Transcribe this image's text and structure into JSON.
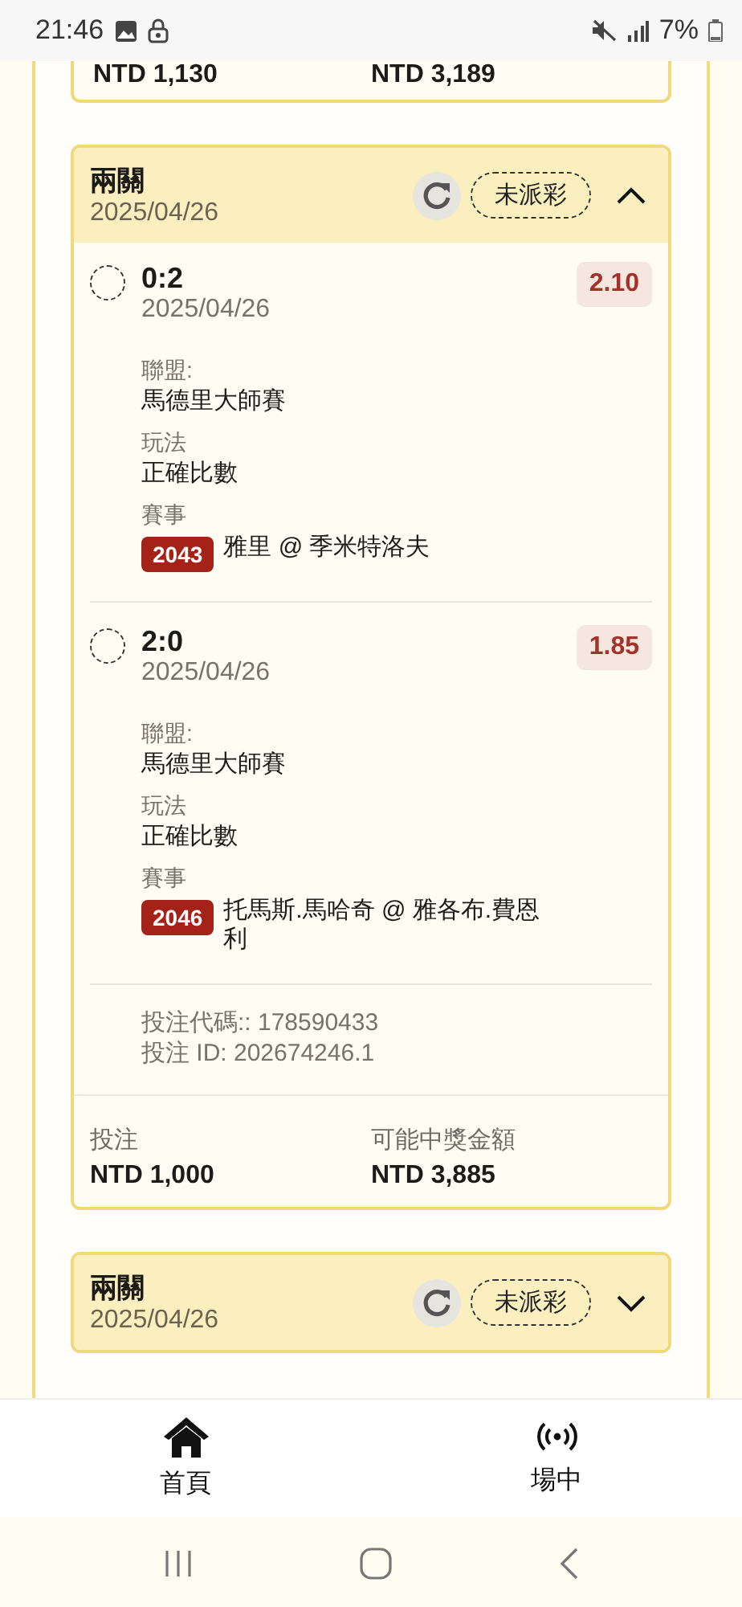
{
  "status_bar": {
    "time": "21:46",
    "battery": "7%"
  },
  "previous_bet_tail": {
    "stake_amount": "NTD 1,130",
    "payout_amount": "NTD 3,189"
  },
  "bets": [
    {
      "expanded": true,
      "type": "兩關",
      "date": "2025/04/26",
      "status": "未派彩",
      "legs": [
        {
          "selected": false,
          "score": "0:2",
          "date": "2025/04/26",
          "odds": "2.10",
          "league_label": "聯盟:",
          "league": "馬德里大師賽",
          "market_label": "玩法",
          "market": "正確比數",
          "event_label": "賽事",
          "event_no": "2043",
          "event": "雅里 @ 季米特洛夫"
        },
        {
          "selected": false,
          "score": "2:0",
          "date": "2025/04/26",
          "odds": "1.85",
          "league_label": "聯盟:",
          "league": "馬德里大師賽",
          "market_label": "玩法",
          "market": "正確比數",
          "event_label": "賽事",
          "event_no": "2046",
          "event": "托馬斯.馬哈奇 @ 雅各布.費恩利"
        }
      ],
      "bet_code": "投注代碼:: 178590433",
      "bet_id": "投注 ID: 202674246.1",
      "stake_label": "投注",
      "stake_amount": "NTD 1,000",
      "payout_label": "可能中獎金額",
      "payout_amount": "NTD 3,885"
    },
    {
      "expanded": false,
      "type": "兩關",
      "date": "2025/04/26",
      "status": "未派彩"
    }
  ],
  "nav": [
    {
      "kind": "home",
      "label": "首頁"
    },
    {
      "kind": "live",
      "label": "場中"
    }
  ]
}
